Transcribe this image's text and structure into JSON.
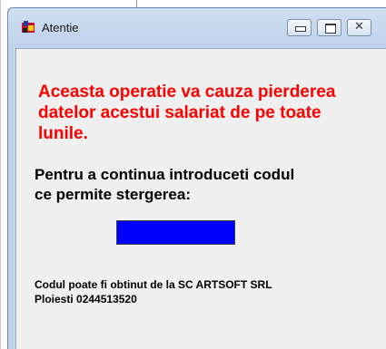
{
  "window": {
    "title": "Atentie",
    "icon": "app-icon",
    "controls": {
      "minimize": "minimize-icon",
      "maximize": "maximize-icon",
      "close": "✕"
    }
  },
  "content": {
    "warning_line1": "Aceasta operatie va cauza pierderea",
    "warning_line2": "datelor acestui salariat de pe toate",
    "warning_line3": "lunile.",
    "prompt_line1": "Pentru a continua introduceti codul",
    "prompt_line2": "ce permite stergerea:",
    "code_value": "",
    "footer_line1": "Codul poate fi obtinut de la SC ARTSOFT SRL",
    "footer_line2": "Ploiesti 0244513520"
  },
  "colors": {
    "warning": "#ff0000",
    "input_background": "#0000ff",
    "client_background": "#f0f0f0",
    "frame": "#bfd2ea"
  }
}
